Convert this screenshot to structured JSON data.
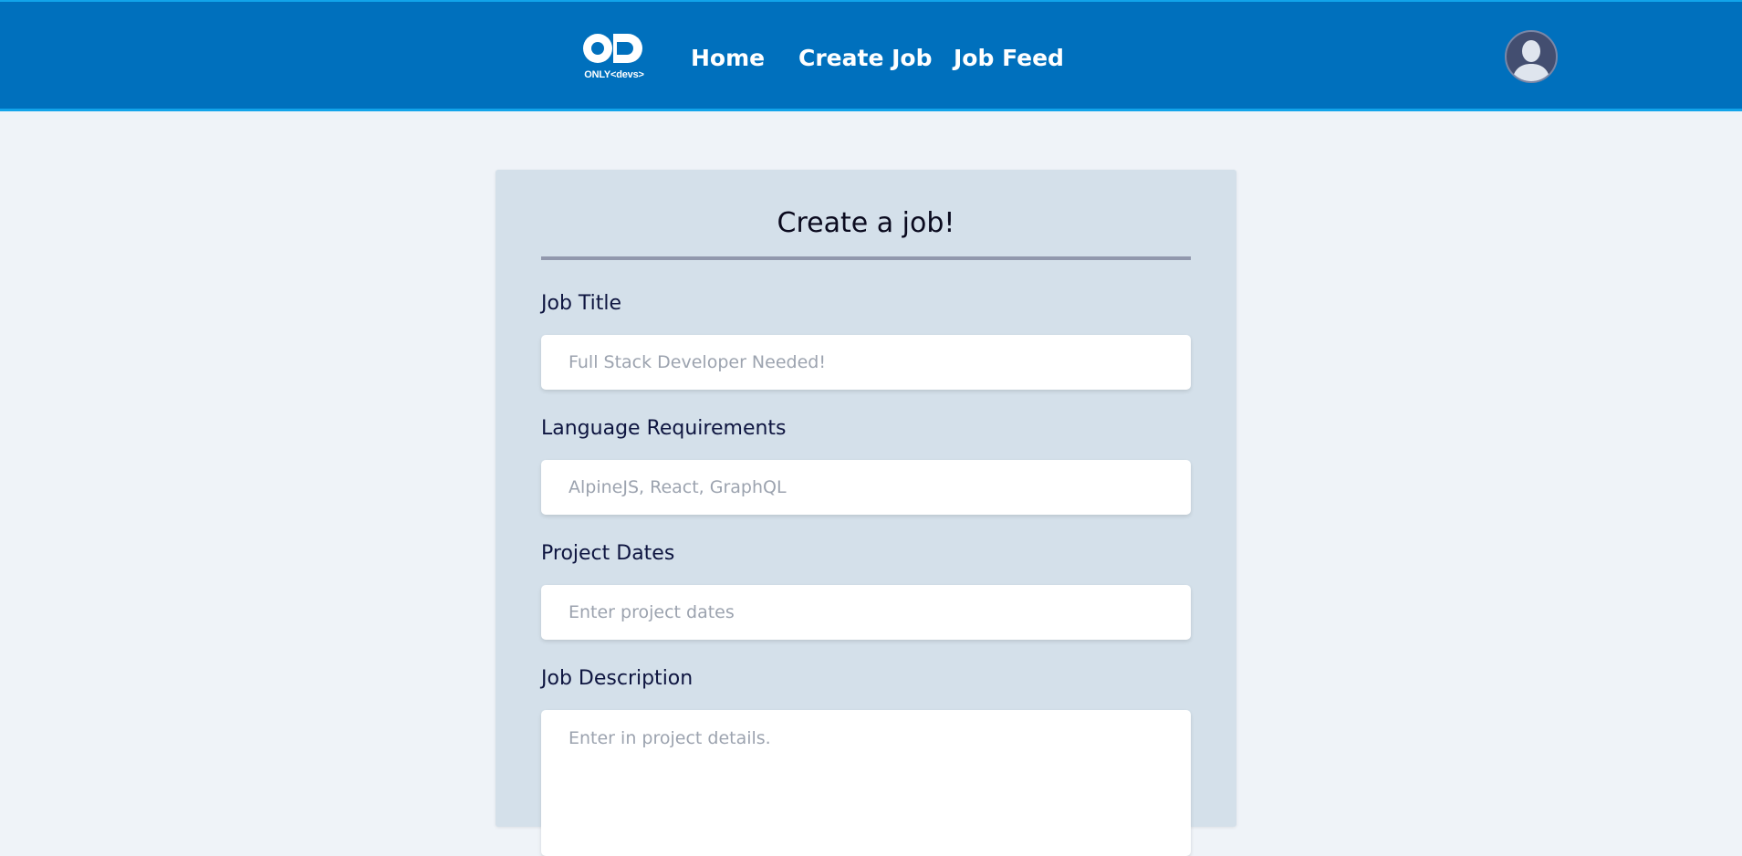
{
  "colors": {
    "navbar_bg": "#0070bd",
    "navbar_border": "#12a4ea",
    "page_bg": "#eff3f8",
    "card_bg": "#d4e0ea",
    "divider": "#9198ad",
    "label_text": "#0e1540",
    "placeholder_text": "#9ca3af"
  },
  "header": {
    "logo_text": "ONLY<devs>",
    "logo_icon": "infinity-od-logo-icon",
    "nav": [
      {
        "label": "Home"
      },
      {
        "label": "Create Job"
      },
      {
        "label": "Job Feed"
      }
    ],
    "avatar_icon": "user-avatar-icon"
  },
  "form": {
    "title": "Create a job!",
    "fields": [
      {
        "label": "Job Title",
        "placeholder": "Full Stack Developer Needed!"
      },
      {
        "label": "Language Requirements",
        "placeholder": "AlpineJS, React, GraphQL"
      },
      {
        "label": "Project Dates",
        "placeholder": "Enter project dates"
      },
      {
        "label": "Job Description",
        "placeholder": "Enter in project details."
      }
    ]
  }
}
